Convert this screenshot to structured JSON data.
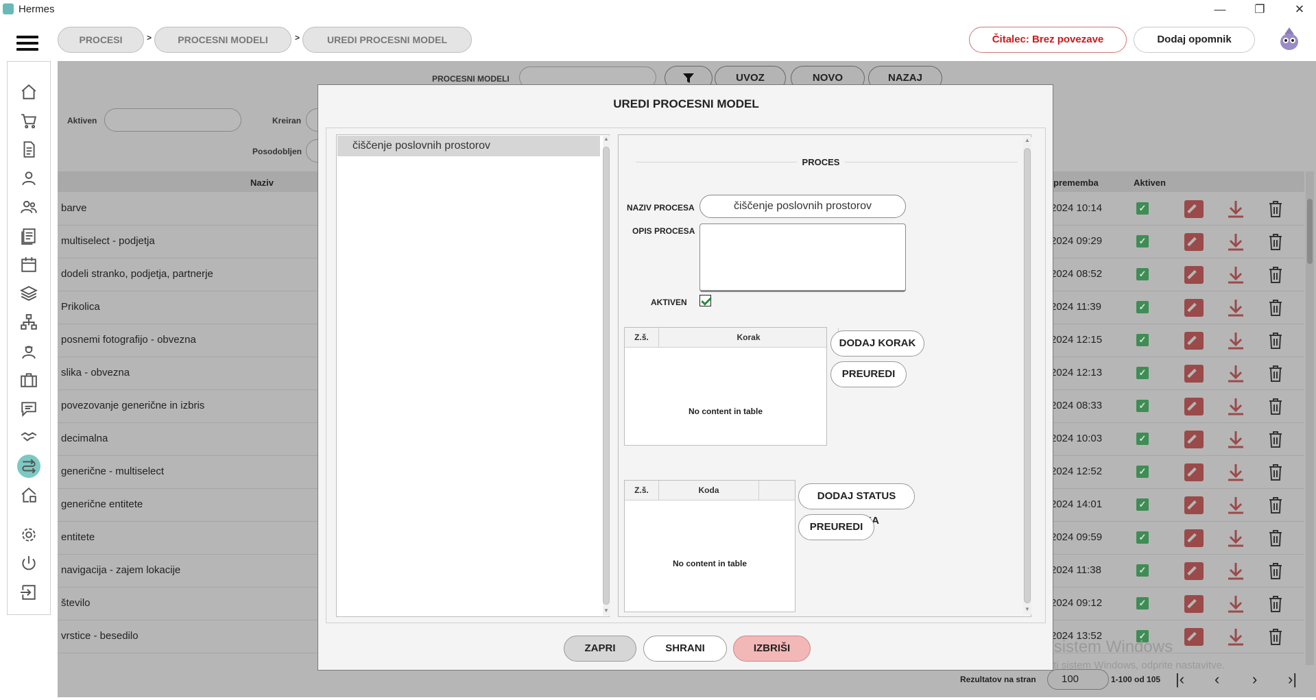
{
  "window": {
    "title": "Hermes",
    "min_icon": "minimize-icon",
    "max_icon": "restore-icon",
    "close_icon": "close-icon"
  },
  "breadcrumb": [
    "PROCESI",
    "PROCESNI MODELI",
    "UREDI PROCESNI MODEL"
  ],
  "breadcrumb_separator": ">",
  "header": {
    "reader_status": "Čitalec: Brez povezave",
    "reminder_button": "Dodaj opomnik"
  },
  "sidebar": {
    "items": [
      "home-icon",
      "cart-icon",
      "document-icon",
      "user-icon",
      "users-icon",
      "list-icon",
      "calendar-icon",
      "layers-icon",
      "hierarchy-icon",
      "worker-icon",
      "briefcase-icon",
      "chat-icon",
      "handshake-icon",
      "process-icon",
      "house-icon",
      "gear-icon",
      "power-icon",
      "logout-icon"
    ],
    "active": "process-icon"
  },
  "background": {
    "search_label": "PROCESNI MODELI",
    "buttons": {
      "import": "UVOZ",
      "new": "NOVO",
      "back": "NAZAJ"
    },
    "filters": {
      "active": "Aktiven",
      "created": "Kreiran",
      "updated": "Posodobljen"
    },
    "columns": {
      "name": "Naziv",
      "changed": "premembа",
      "active": "Aktiven"
    },
    "rows": [
      {
        "name": "barve",
        "date": "2024 10:14"
      },
      {
        "name": "multiselect - podjetja",
        "date": "2024 09:29"
      },
      {
        "name": "dodeli stranko, podjetja, partnerje",
        "date": "2024 08:52"
      },
      {
        "name": "Prikolica",
        "date": "2024 11:39"
      },
      {
        "name": "posnemi fotografijo - obvezna",
        "date": "2024 12:15"
      },
      {
        "name": "slika - obvezna",
        "date": "2024 12:13"
      },
      {
        "name": "povezovanje generične in izbris",
        "date": "2024 08:33"
      },
      {
        "name": "decimalna",
        "date": "2024 10:03"
      },
      {
        "name": "generične - multiselect",
        "date": "2024 12:52"
      },
      {
        "name": "generične entitete",
        "date": "2024 14:01"
      },
      {
        "name": "entitete",
        "date": "2024 09:59"
      },
      {
        "name": "navigacija - zajem lokacije",
        "date": "2024 11:38"
      },
      {
        "name": "število",
        "date": "2024 09:12"
      },
      {
        "name": "vrstice - besedilo",
        "date": "2024 13:52"
      }
    ],
    "pager": {
      "label": "Rezultatov na stran",
      "size": "100",
      "range": "1-100 od 105"
    }
  },
  "watermark": {
    "line1": "Aktivirajte sistem Windows",
    "line2": "Če želite aktivirati sistem Windows, odprite nastavitve."
  },
  "modal": {
    "title": "UREDI PROCESNI MODEL",
    "list_items": [
      "čiščenje poslovnih prostorov"
    ],
    "section_title": "PROCES",
    "fields": {
      "name_label": "NAZIV PROCESA",
      "name_value": "čiščenje poslovnih prostorov",
      "desc_label": "OPIS PROCESA",
      "desc_value": "",
      "active_label": "AKTIVEN",
      "active_checked": true
    },
    "steps_table": {
      "col_seq": "Z.š.",
      "col_step": "Korak",
      "empty": "No content in table"
    },
    "steps_buttons": {
      "add": "DODAJ KORAK",
      "reorder": "PREUREDI"
    },
    "status_table": {
      "col_seq": "Z.š.",
      "col_code": "Koda",
      "empty": "No content in table"
    },
    "status_buttons": {
      "add": "DODAJ STATUS KORAKA",
      "reorder": "PREUREDI"
    },
    "footer": {
      "close": "ZAPRI",
      "save": "SHRANI",
      "delete": "IZBRIŠI"
    }
  }
}
